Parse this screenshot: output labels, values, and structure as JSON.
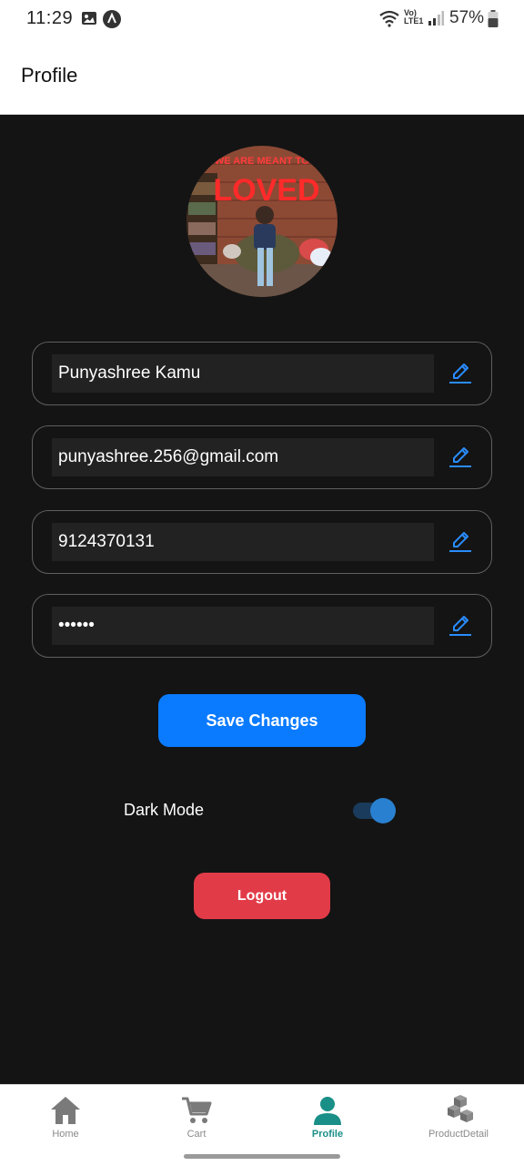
{
  "status_bar": {
    "time": "11:29",
    "battery": "57%"
  },
  "header": {
    "title": "Profile"
  },
  "profile": {
    "name": "Punyashree Kamu",
    "email": "punyashree.256@gmail.com",
    "phone": "9124370131",
    "password_mask": "••••••",
    "avatar_sign_text": [
      "WE ARE MEANT TO BE",
      "LOVED"
    ]
  },
  "actions": {
    "save_label": "Save Changes",
    "logout_label": "Logout"
  },
  "settings": {
    "dark_mode_label": "Dark Mode",
    "dark_mode_on": true
  },
  "nav": {
    "items": [
      {
        "label": "Home",
        "icon": "home-icon"
      },
      {
        "label": "Cart",
        "icon": "cart-icon"
      },
      {
        "label": "Profile",
        "icon": "person-icon",
        "active": true
      },
      {
        "label": "ProductDetail",
        "icon": "cubes-icon"
      }
    ]
  },
  "colors": {
    "accent": "#0a7bff",
    "logout": "#e23b48",
    "active_tab": "#1a8f87",
    "background": "#141414"
  }
}
